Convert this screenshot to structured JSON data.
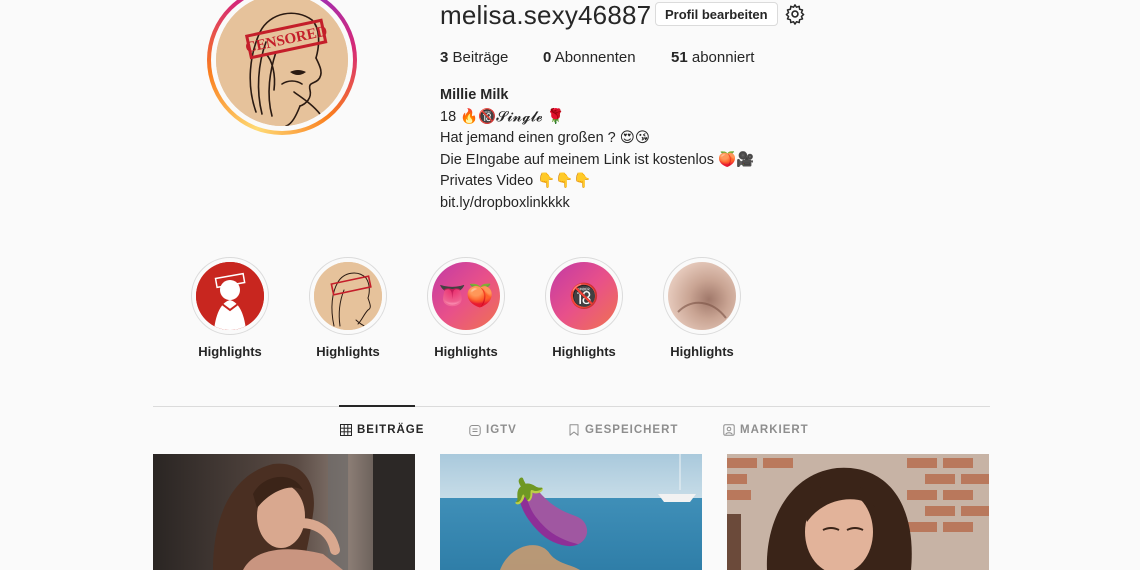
{
  "profile": {
    "username": "melisa.sexy46887",
    "edit_button": "Profil bearbeiten",
    "settings_icon": "gear-icon",
    "avatar_stamp": "CENSORED"
  },
  "stats": {
    "posts_count": "3",
    "posts_label": "Beiträge",
    "followers_count": "0",
    "followers_label": "Abonnenten",
    "following_count": "51",
    "following_label": "abonniert"
  },
  "bio": {
    "name": "Millie Milk",
    "line1": "18 🔥🔞𝓢𝓲𝓷𝓰𝓵𝓮 🌹",
    "line2": "Hat jemand einen großen ? 😍😘",
    "line3": "Die EIngabe auf meinem Link ist kostenlos 🍑🎥",
    "line4": "Privates Video  👇👇👇",
    "link": "bit.ly/dropboxlinkkkk"
  },
  "highlights": [
    {
      "label": "Highlights",
      "emoji": ""
    },
    {
      "label": "Highlights",
      "emoji": ""
    },
    {
      "label": "Highlights",
      "emoji": "👅🍑"
    },
    {
      "label": "Highlights",
      "emoji": "🔞"
    },
    {
      "label": "Highlights",
      "emoji": ""
    }
  ],
  "tabs": [
    {
      "label": "BEITRÄGE",
      "icon": "grid-icon",
      "active": true
    },
    {
      "label": "IGTV",
      "icon": "igtv-icon",
      "active": false
    },
    {
      "label": "GESPEICHERT",
      "icon": "bookmark-icon",
      "active": false
    },
    {
      "label": "MARKIERT",
      "icon": "tagged-icon",
      "active": false
    }
  ],
  "posts": [
    {
      "emoji": ""
    },
    {
      "emoji": "🍆"
    },
    {
      "emoji": ""
    }
  ],
  "colors": {
    "ring_gradient": [
      "#feda75",
      "#fa7e1e",
      "#d62976",
      "#962fbf"
    ],
    "text": "#262626",
    "muted": "#8e8e8e",
    "border": "#dbdbdb"
  }
}
